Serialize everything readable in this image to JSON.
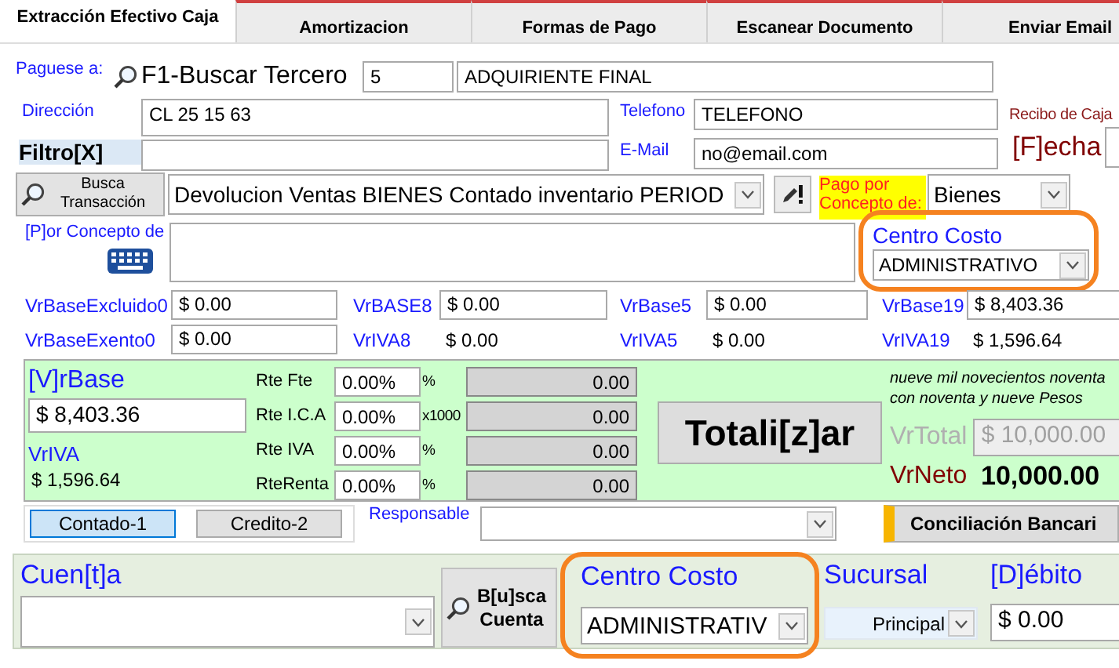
{
  "tabs": [
    {
      "label": "Extracción Efectivo Caja",
      "selected": true
    },
    {
      "label": "Amortizacion",
      "selected": false
    },
    {
      "label": "Formas de Pago",
      "selected": false
    },
    {
      "label": "Escanear Documento",
      "selected": false
    },
    {
      "label": "Enviar Email",
      "selected": false
    }
  ],
  "payee": {
    "label": "Paguese a:",
    "search": "F1-Buscar Tercero",
    "code": "5",
    "name": "ADQUIRIENTE  FINAL"
  },
  "receipt_label": "Recibo de Caja",
  "date_label": "[F]echa",
  "address": {
    "label": "Dirección",
    "value": "CL 25 15 63"
  },
  "phone": {
    "label": "Telefono",
    "value": "TELEFONO"
  },
  "filter": {
    "label": "Filtro[X]"
  },
  "email": {
    "label": "E-Mail",
    "value": "no@email.com"
  },
  "transaction": {
    "button": "Busca Transacción",
    "value": "Devolucion Ventas BIENES Contado inventario PERIOD"
  },
  "payment_concept": {
    "label": "Pago por Concepto de:",
    "value": "Bienes"
  },
  "concept": {
    "label": "[P]or Concepto de"
  },
  "cost_center": {
    "label": "Centro Costo",
    "value": "ADMINISTRATIVO"
  },
  "bases": [
    {
      "label": "VrBaseExcluido0",
      "value": "$ 0.00",
      "kind": "field"
    },
    {
      "label": "VrBASE8",
      "value": "$ 0.00",
      "kind": "field"
    },
    {
      "label": "VrBase5",
      "value": "$ 0.00",
      "kind": "field"
    },
    {
      "label": "VrBase19",
      "value": "$ 8,403.36",
      "kind": "field"
    },
    {
      "label": "VrBaseExento0",
      "value": "$ 0.00",
      "kind": "field"
    },
    {
      "label": "VrIVA8",
      "value": "$ 0.00",
      "kind": "text"
    },
    {
      "label": "VrIVA5",
      "value": "$ 0.00",
      "kind": "text"
    },
    {
      "label": "VrIVA19",
      "value": "$ 1,596.64",
      "kind": "text"
    }
  ],
  "totals": {
    "base": {
      "label": "[V]rBase",
      "value": "$ 8,403.36"
    },
    "iva": {
      "label": "VrIVA",
      "value": "$ 1,596.64"
    },
    "withholdings": [
      {
        "label": "Rte Fte",
        "rate": "0.00%",
        "unit": "%",
        "amount": "0.00"
      },
      {
        "label": "Rte I.C.A",
        "rate": "0.00%",
        "unit": "x1000",
        "amount": "0.00"
      },
      {
        "label": "Rte IVA",
        "rate": "0.00%",
        "unit": "%",
        "amount": "0.00"
      },
      {
        "label": "RteRenta",
        "rate": "0.00%",
        "unit": "%",
        "amount": "0.00"
      }
    ],
    "totalize_button": "Totali[z]ar",
    "amount_words": "nueve mil novecientos noventa con noventa y nueve Pesos",
    "total": {
      "label": "VrTotal",
      "value": "$ 10,000.00",
      "disabled": true
    },
    "net": {
      "label": "VrNeto",
      "value": "10,000.00"
    }
  },
  "payment_modes": [
    {
      "label": "Contado-1",
      "selected": true
    },
    {
      "label": "Credito-2",
      "selected": false
    }
  ],
  "responsible": {
    "label": "Responsable"
  },
  "reconciliation_button": "Conciliación Bancari",
  "entry": {
    "account_label": "Cuen[t]a",
    "search_button": "B[u]sca Cuenta",
    "cost_center": {
      "label": "Centro Costo",
      "value": "ADMINISTRATIV"
    },
    "branch": {
      "label": "Sucursal",
      "value": "Principal"
    },
    "debit": {
      "label": "[D]ébito",
      "value": "$ 0.00"
    }
  }
}
